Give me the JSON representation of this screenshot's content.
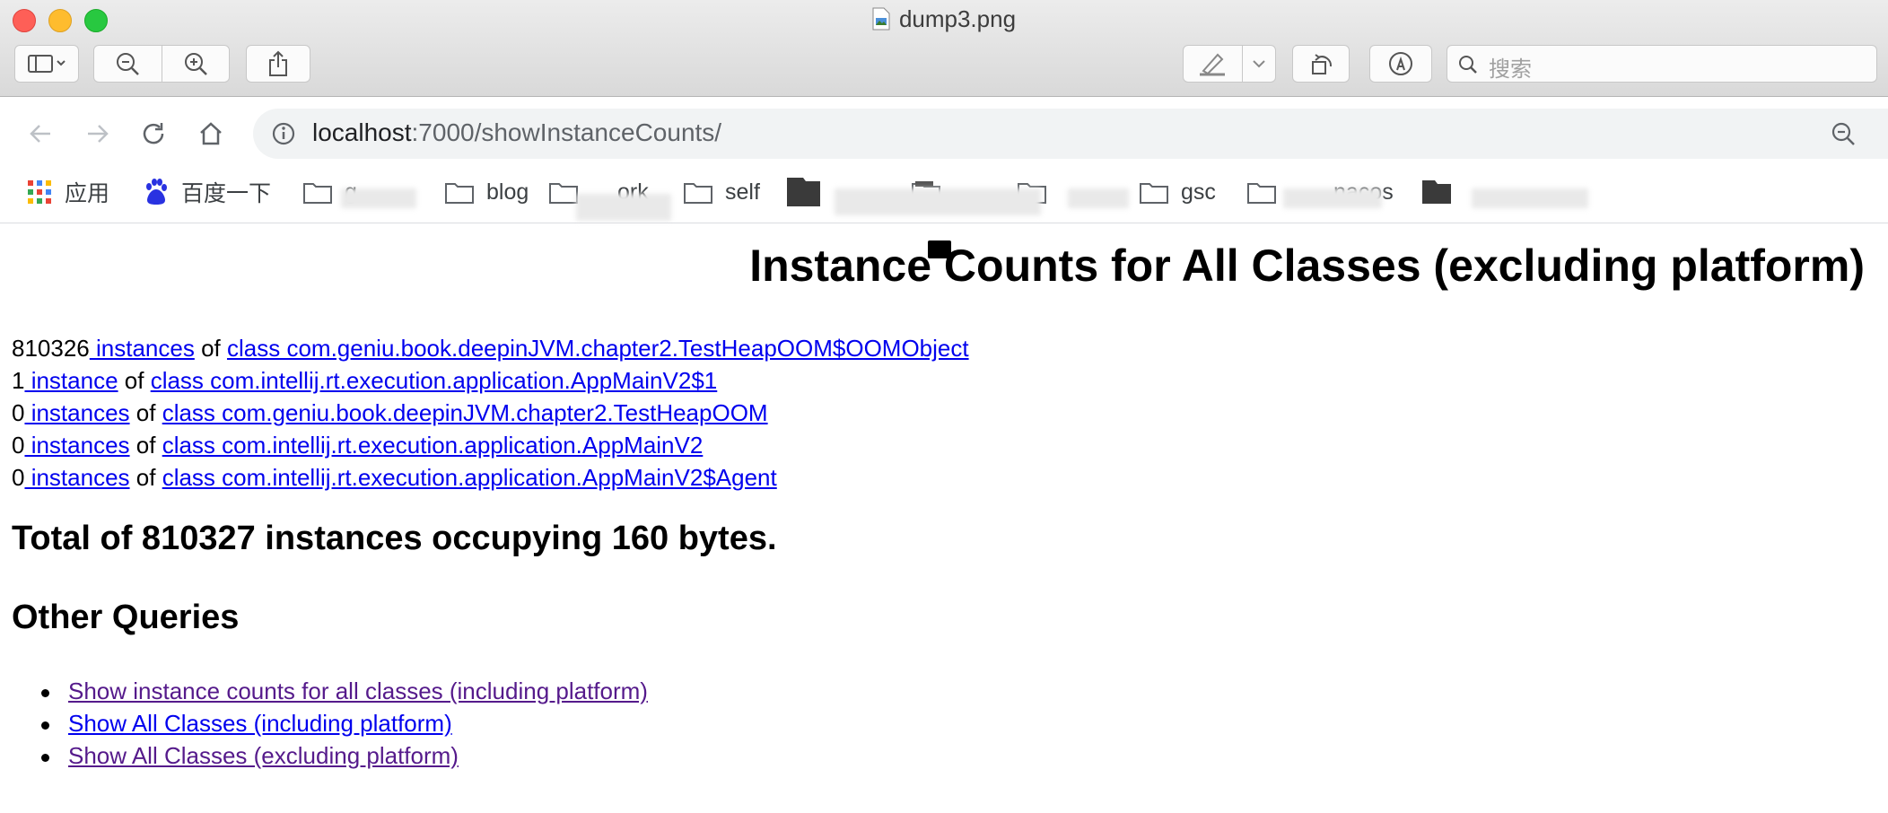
{
  "window": {
    "title": "dump3.png",
    "search_placeholder": "搜索"
  },
  "browser": {
    "url_host": "localhost",
    "url_rest": ":7000/showInstanceCounts/",
    "bookmarks": [
      {
        "label": "应用",
        "icon": "apps-grid-icon"
      },
      {
        "label": "百度一下",
        "icon": "baidu-paw-icon"
      },
      {
        "label": "g",
        "icon": "folder-icon"
      },
      {
        "label": "blog",
        "icon": "folder-icon"
      },
      {
        "label": "ork",
        "icon": "folder-icon"
      },
      {
        "label": "self",
        "icon": "folder-icon"
      },
      {
        "label": "",
        "icon": "folder-dark-icon"
      },
      {
        "label": "",
        "icon": "folder-icon"
      },
      {
        "label": "",
        "icon": "folder-icon"
      },
      {
        "label": "gsc",
        "icon": "folder-icon"
      },
      {
        "label": "nacos",
        "icon": "folder-icon"
      },
      {
        "label": "",
        "icon": "folder-dark-icon"
      }
    ]
  },
  "page": {
    "title": "Instance Counts for All Classes (excluding platform)",
    "rows": [
      {
        "count": "810326",
        "link": " instances",
        "of": " of ",
        "class": "class com.geniu.book.deepinJVM.chapter2.TestHeapOOM$OOMObject"
      },
      {
        "count": "1",
        "link": " instance",
        "of": " of ",
        "class": "class com.intellij.rt.execution.application.AppMainV2$1"
      },
      {
        "count": "0",
        "link": " instances",
        "of": " of ",
        "class": "class com.geniu.book.deepinJVM.chapter2.TestHeapOOM"
      },
      {
        "count": "0",
        "link": " instances",
        "of": " of ",
        "class": "class com.intellij.rt.execution.application.AppMainV2"
      },
      {
        "count": "0",
        "link": " instances",
        "of": " of ",
        "class": "class com.intellij.rt.execution.application.AppMainV2$Agent"
      }
    ],
    "total": "Total of 810327 instances occupying 160 bytes.",
    "other_heading": "Other Queries",
    "queries": [
      "Show instance counts for all classes (including platform)",
      "Show All Classes (including platform)",
      "Show All Classes (excluding platform)"
    ]
  }
}
